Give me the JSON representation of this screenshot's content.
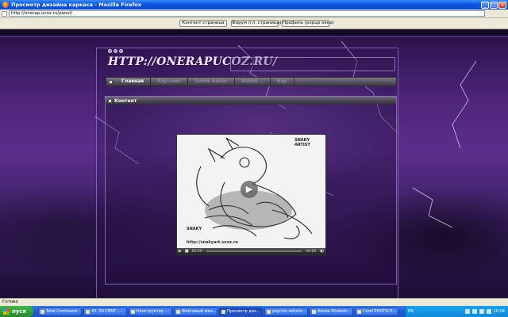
{
  "window": {
    "title": "Просмотр дизайна каркаса - Mozilla Firefox",
    "controls": {
      "minimize": "_",
      "maximize": "□",
      "close": "✕"
    }
  },
  "browser": {
    "url": "http://onerap.ucoz.ru/panel/",
    "buttons": [
      {
        "label": "Контент страница"
      },
      {
        "label": "Форум (гл. страница)"
      },
      {
        "label": "Профиль (popup окно)"
      }
    ],
    "status": "Готово"
  },
  "site": {
    "title": "HTTP://ONERAPUCOZ.RU/",
    "nav": [
      {
        "label": "Главная",
        "active": true
      },
      {
        "label": "Rap сайт",
        "active": false
      },
      {
        "label": "Game Radar",
        "active": false
      },
      {
        "label": "Warez...",
        "active": false
      },
      {
        "label": "Rap",
        "active": false
      }
    ],
    "content_header": "Контент"
  },
  "player": {
    "overlay_top": "SNAKY ARTIST",
    "overlay_logo": "SNAKY",
    "overlay_url": "http://snakyart.ucoz.ru",
    "time_current": "00:00",
    "time_total": "00:00",
    "play_glyph": "▶",
    "stop_glyph": "■",
    "volume_glyph": "◀)"
  },
  "taskbar": {
    "start_label": "пуск",
    "tasks": [
      {
        "label": "Total Command...",
        "active": false
      },
      {
        "label": "43. 50 CENT -...",
        "active": false
      },
      {
        "label": "Конструктор ...",
        "active": false
      },
      {
        "label": "Файловый мен...",
        "active": false
      },
      {
        "label": "Просмотр диз...",
        "active": true
      },
      {
        "label": "psychic-astrolo...",
        "active": false
      },
      {
        "label": "Adobe Photosh...",
        "active": false
      },
      {
        "label": "Corel PHOTO-P...",
        "active": false
      }
    ],
    "language": "EN",
    "clock": "10:04"
  },
  "colors": {
    "xp_blue": "#245edb",
    "page_purple": "#4b2478",
    "nav_gray": "#55515f",
    "active_text": "#ffffff"
  }
}
